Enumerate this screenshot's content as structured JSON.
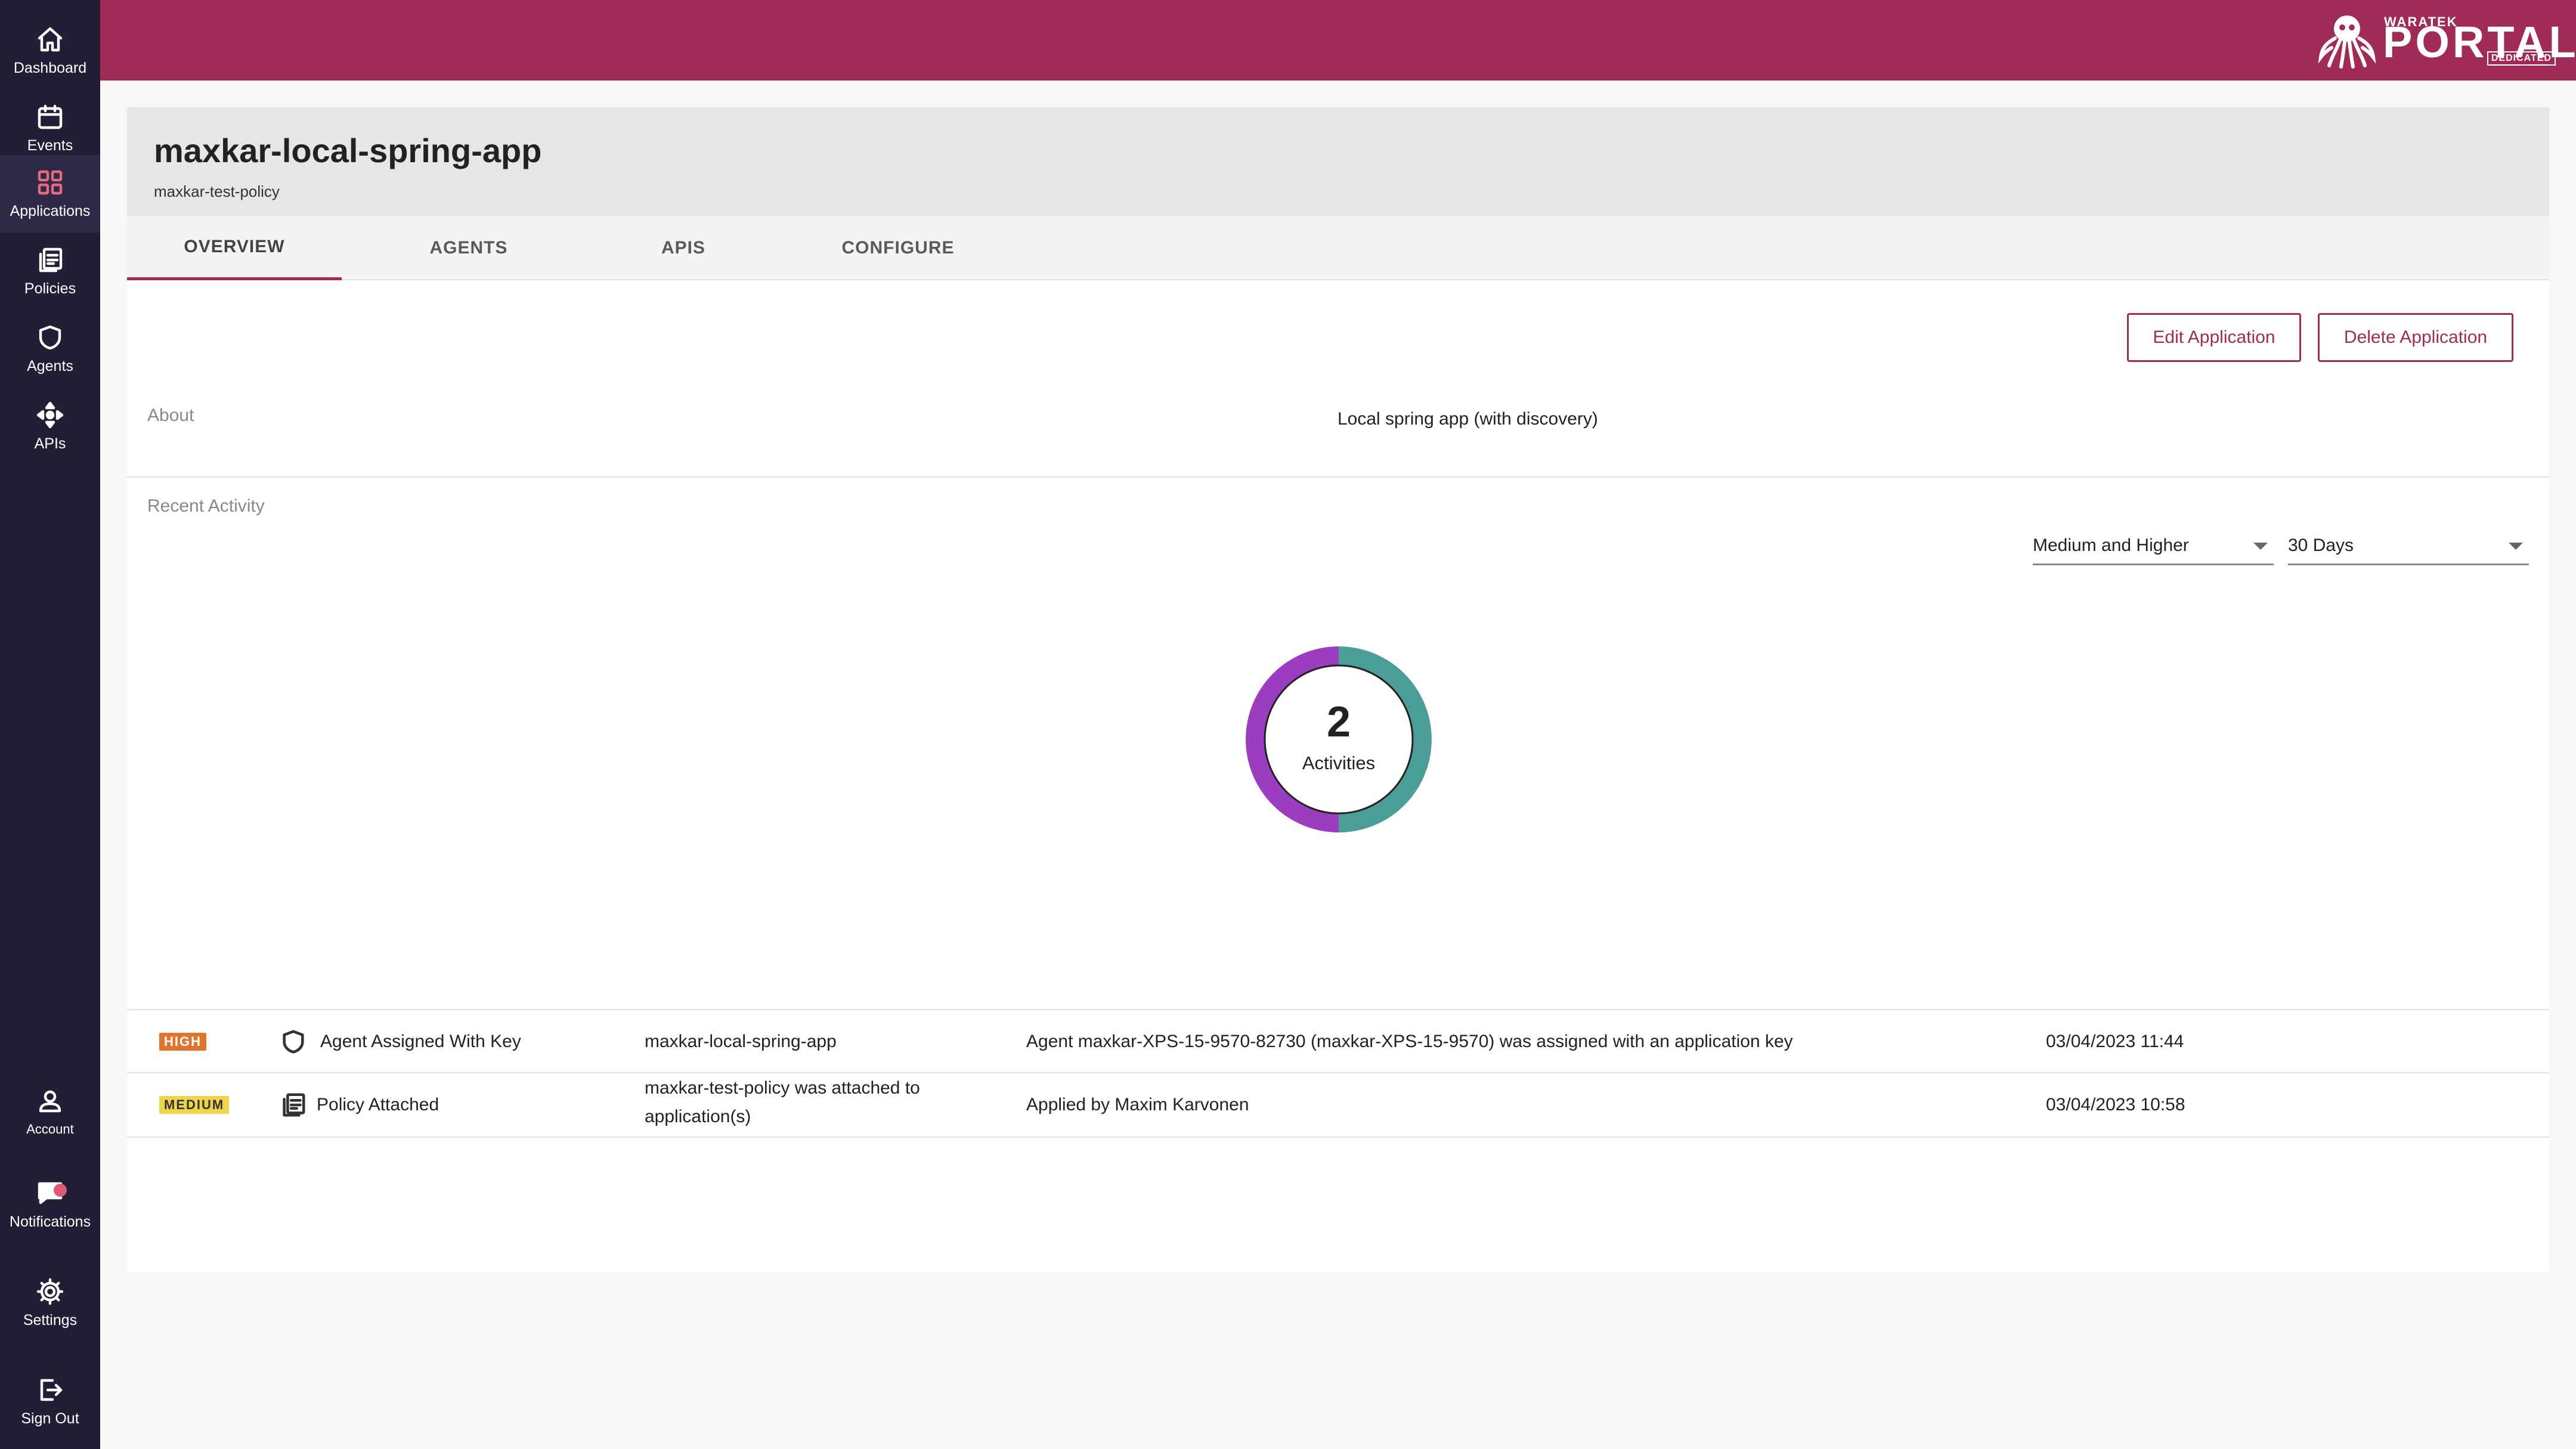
{
  "sidebar": {
    "items": [
      {
        "label": "Dashboard",
        "icon": "home-icon"
      },
      {
        "label": "Events",
        "icon": "calendar-icon"
      },
      {
        "label": "Applications",
        "icon": "grid-icon",
        "active": true
      },
      {
        "label": "Policies",
        "icon": "document-icon"
      },
      {
        "label": "Agents",
        "icon": "shield-icon"
      },
      {
        "label": "APIs",
        "icon": "arrows-icon"
      }
    ],
    "bottom": [
      {
        "label": "Account",
        "icon": "person-icon"
      },
      {
        "label": "Notifications",
        "icon": "chat-icon"
      },
      {
        "label": "Settings",
        "icon": "gear-icon"
      },
      {
        "label": "Sign Out",
        "icon": "sign-out-icon"
      }
    ]
  },
  "header": {
    "logo_small": "WARATEK",
    "logo_big": "PORTAL",
    "logo_tag": "DEDICATED"
  },
  "app": {
    "title": "maxkar-local-spring-app",
    "subtitle": "maxkar-test-policy"
  },
  "tabs": [
    "OVERVIEW",
    "AGENTS",
    "APIS",
    "CONFIGURE"
  ],
  "active_tab": "OVERVIEW",
  "actions": {
    "edit": "Edit Application",
    "delete": "Delete Application"
  },
  "about": {
    "label": "About",
    "value": "Local spring app (with discovery)"
  },
  "recent_activity": {
    "label": "Recent Activity",
    "severity_filter": "Medium and Higher",
    "period_filter": "30 Days",
    "count": "2",
    "count_label": "Activities",
    "donut": [
      {
        "severity": "HIGH",
        "fraction": 0.5,
        "color": "#4a9e97"
      },
      {
        "severity": "MEDIUM",
        "fraction": 0.5,
        "color": "#9b3dbf"
      }
    ]
  },
  "activities": [
    {
      "severity": "HIGH",
      "severity_color": "#e0762e",
      "severity_text_color": "#ffffff",
      "icon": "shield-icon",
      "type": "Agent Assigned With Key",
      "target": "maxkar-local-spring-app",
      "description": "Agent maxkar-XPS-15-9570-82730 (maxkar-XPS-15-9570) was assigned with an application key",
      "timestamp": "03/04/2023 11:44"
    },
    {
      "severity": "MEDIUM",
      "severity_color": "#f0d44a",
      "severity_text_color": "#333333",
      "icon": "document-icon",
      "type": "Policy Attached",
      "target_line1": "maxkar-test-policy was attached to",
      "target_line2": "application(s)",
      "description": "Applied by Maxim Karvonen",
      "timestamp": "03/04/2023 10:58"
    }
  ]
}
